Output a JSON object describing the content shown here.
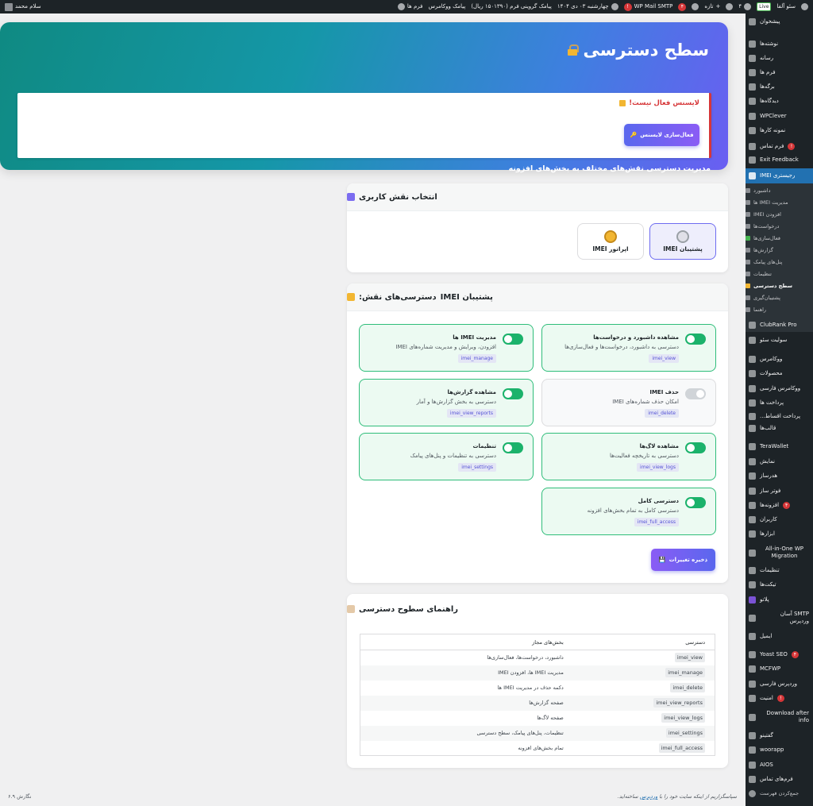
{
  "adminbar": {
    "right_items": [
      "سئو آلفا",
      "۴",
      "تازه",
      "۴",
      "WP Mail SMTP",
      "چهارشنبه ۰۳ دی ۱۴۰۴",
      "پیامک گروینی فرم (۱۵۰۱۳۹۰ ریال)",
      "پیامک ووکامرس",
      "فرم ها"
    ],
    "live": "Live",
    "greeting": "سلام محمد",
    "badge_mail": "!",
    "badge_four": "۴"
  },
  "menu": {
    "items": [
      {
        "label": "پیشخوان"
      },
      {
        "label": "نوشته‌ها"
      },
      {
        "label": "رسانه"
      },
      {
        "label": "فرم ها"
      },
      {
        "label": "برگه‌ها"
      },
      {
        "label": "دیدگاه‌ها"
      },
      {
        "label": "WPClever"
      },
      {
        "label": "نمونه کارها"
      },
      {
        "label": "فرم تماس",
        "badge": "!"
      },
      {
        "label": "Exit Feedback"
      },
      {
        "label": "رجیستری IMEI"
      },
      {
        "label": "ClubRank Pro"
      },
      {
        "label": "سولیت سئو"
      },
      {
        "label": "ووکامرس"
      },
      {
        "label": "محصولات"
      },
      {
        "label": "ووکامرس فارسی"
      },
      {
        "label": "پرداخت ها"
      },
      {
        "label": "پرداخت اقساط..."
      },
      {
        "label": "قالب‌ها"
      },
      {
        "label": "TeraWallet"
      },
      {
        "label": "نمایش"
      },
      {
        "label": "هدرساز"
      },
      {
        "label": "فوتر ساز"
      },
      {
        "label": "افزونه‌ها",
        "badge": "۴"
      },
      {
        "label": "کاربران"
      },
      {
        "label": "ابزارها"
      },
      {
        "label": "All-in-One WP Migration"
      },
      {
        "label": "تنظیمات"
      },
      {
        "label": "تیکت‌ها"
      },
      {
        "label": "پلاتو"
      },
      {
        "label": "SMTP آسان وردپرس"
      },
      {
        "label": "ایمیل"
      },
      {
        "label": "Yoast SEO",
        "badge": "۴"
      },
      {
        "label": "MCFWP"
      },
      {
        "label": "وردپرس فارسی"
      },
      {
        "label": "امنیت",
        "badge": "!"
      },
      {
        "label": "Download after info"
      },
      {
        "label": "گفتینو"
      },
      {
        "label": "woorapp"
      },
      {
        "label": "AIOS"
      },
      {
        "label": "فرم‌های تماس"
      },
      {
        "label": "جمع‌کردن فهرست"
      }
    ],
    "submenu": [
      "داشبورد",
      "مدیریت IMEI ها",
      "افزودن IMEI",
      "درخواست‌ها",
      "فعال‌سازی‌ها",
      "گزارش‌ها",
      "پنل‌های پیامک",
      "تنظیمات",
      "سطح دسترسی",
      "پشتیبان‌گیری",
      "راهنما"
    ]
  },
  "hero": {
    "title": "سطح دسترسی",
    "license_msg": "لایسنس فعال نیست!",
    "activate_label": "فعال‌سازی لایسنس",
    "subtitle": "مدیریت دسترسی نقش‌های مختلف به بخش‌های افزونه"
  },
  "roles": {
    "title": "انتخاب نقش کاربری",
    "items": [
      {
        "label": "پشتیبان IMEI",
        "selected": true
      },
      {
        "label": "اپراتور IMEI",
        "selected": false
      }
    ]
  },
  "perms": {
    "title_prefix": "دسترسی‌های نقش:",
    "title_role": "پشتیبان IMEI",
    "save_label": "ذخیره تغییرات",
    "items": [
      {
        "title": "مشاهده داشبورد و درخواست‌ها",
        "desc": "دسترسی به داشبورد، درخواست‌ها و فعال‌سازی‌ها",
        "code": "imei_view",
        "on": true
      },
      {
        "title": "مدیریت IMEI ها",
        "desc": "افزودن، ویرایش و مدیریت شماره‌های IMEI",
        "code": "imei_manage",
        "on": true
      },
      {
        "title": "حذف IMEI",
        "desc": "امکان حذف شماره‌های IMEI",
        "code": "imei_delete",
        "on": false
      },
      {
        "title": "مشاهده گزارش‌ها",
        "desc": "دسترسی به بخش گزارش‌ها و آمار",
        "code": "imei_view_reports",
        "on": true
      },
      {
        "title": "مشاهده لاگ‌ها",
        "desc": "دسترسی به تاریخچه فعالیت‌ها",
        "code": "imei_view_logs",
        "on": true
      },
      {
        "title": "تنظیمات",
        "desc": "دسترسی به تنظیمات و پنل‌های پیامک",
        "code": "imei_settings",
        "on": true
      },
      {
        "title": "دسترسی کامل",
        "desc": "دسترسی کامل به تمام بخش‌های افزونه",
        "code": "imei_full_access",
        "on": true
      }
    ]
  },
  "guide": {
    "title": "راهنمای سطوح دسترسی",
    "col_access": "دسترسی",
    "col_sections": "بخش‌های مجاز",
    "rows": [
      {
        "code": "imei_view",
        "sections": "داشبورد، درخواست‌ها، فعال‌سازی‌ها"
      },
      {
        "code": "imei_manage",
        "sections": "مدیریت IMEI ها، افزودن IMEI"
      },
      {
        "code": "imei_delete",
        "sections": "دکمه حذف در مدیریت IMEI ها"
      },
      {
        "code": "imei_view_reports",
        "sections": "صفحه گزارش‌ها"
      },
      {
        "code": "imei_view_logs",
        "sections": "صفحه لاگ‌ها"
      },
      {
        "code": "imei_settings",
        "sections": "تنظیمات، پنل‌های پیامک، سطح دسترسی"
      },
      {
        "code": "imei_full_access",
        "sections": "تمام بخش‌های افزونه"
      }
    ]
  },
  "footer": {
    "thanks_prefix": "سپاسگزاریم از اینکه سایت خود را با",
    "thanks_link": "وردپرس",
    "thanks_suffix": "ساخته‌اید.",
    "version": "نگارش ۶.۹"
  },
  "colors": {
    "accent": "#2271b1",
    "toggle_on": "#1bb26b",
    "error": "#d63638",
    "hero_from": "#0f8a82",
    "hero_to": "#6a5ef2"
  }
}
